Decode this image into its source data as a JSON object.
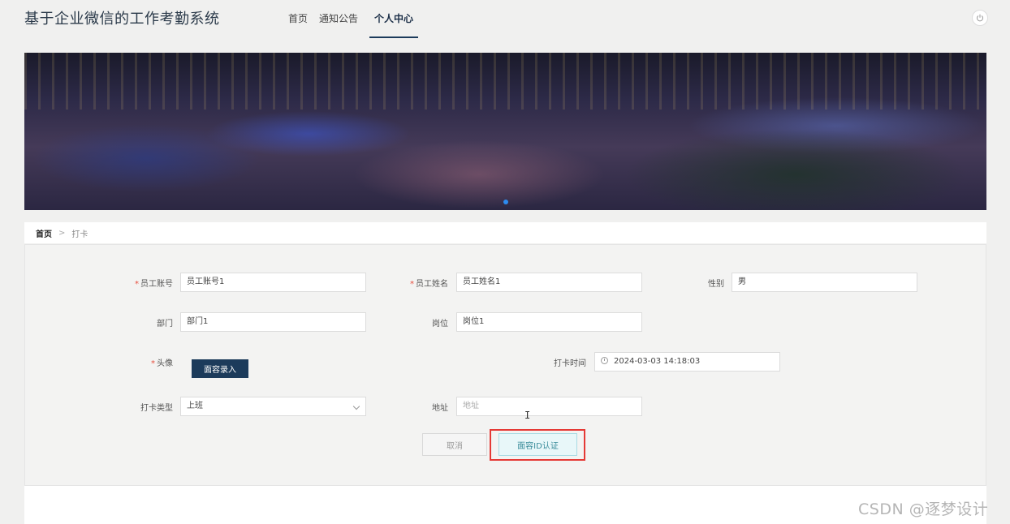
{
  "header": {
    "app_title": "基于企业微信的工作考勤系统",
    "nav": [
      {
        "label": "首页",
        "active": false
      },
      {
        "label": "通知公告",
        "active": false
      },
      {
        "label": "个人中心",
        "active": true
      }
    ],
    "power_icon": "power-icon"
  },
  "banner": {
    "active_slide": 1,
    "dot_color": "#2d8cf0"
  },
  "breadcrumb": {
    "home": "首页",
    "separator": ">",
    "current": "打卡"
  },
  "form": {
    "employee_account": {
      "label": "员工账号",
      "required": true,
      "value": "员工账号1"
    },
    "employee_name": {
      "label": "员工姓名",
      "required": true,
      "value": "员工姓名1"
    },
    "gender": {
      "label": "性别",
      "value": "男"
    },
    "department": {
      "label": "部门",
      "value": "部门1"
    },
    "position": {
      "label": "岗位",
      "value": "岗位1"
    },
    "avatar": {
      "label": "头像",
      "required": true,
      "button": "面容录入"
    },
    "punch_time": {
      "label": "打卡时间",
      "value": "2024-03-03 14:18:03"
    },
    "punch_type": {
      "label": "打卡类型",
      "value": "上班"
    },
    "address": {
      "label": "地址",
      "placeholder": "地址"
    }
  },
  "actions": {
    "cancel": "取消",
    "verify": "面容ID认证"
  },
  "watermark": "CSDN @逐梦设计",
  "colors": {
    "primary": "#1c3b5b",
    "required": "#e74c3c",
    "highlight": "#e53935",
    "verify_bg": "#e8f7f9"
  }
}
